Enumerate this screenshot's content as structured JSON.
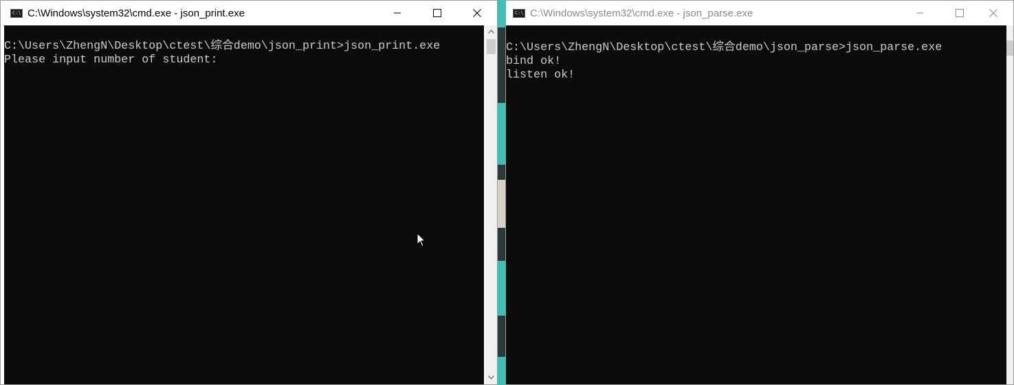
{
  "left_window": {
    "title": "C:\\Windows\\system32\\cmd.exe - json_print.exe",
    "icon": "cmd-icon",
    "icon_text": "C:\\",
    "lines": [
      "C:\\Users\\ZhengN\\Desktop\\ctest\\综合demo\\json_print>json_print.exe",
      "Please input number of student:"
    ]
  },
  "right_window": {
    "title": "C:\\Windows\\system32\\cmd.exe - json_parse.exe",
    "icon": "cmd-icon",
    "icon_text": "C:\\",
    "lines": [
      "C:\\Users\\ZhengN\\Desktop\\ctest\\综合demo\\json_parse>json_parse.exe",
      "bind ok!",
      "listen ok!"
    ]
  },
  "caption_buttons": [
    "minimize-icon",
    "maximize-icon",
    "close-icon"
  ],
  "colors": {
    "console_bg": "#0c0c0c",
    "console_text": "#cccccc",
    "active_title": "#000000",
    "inactive_title": "#8a8a8a"
  }
}
